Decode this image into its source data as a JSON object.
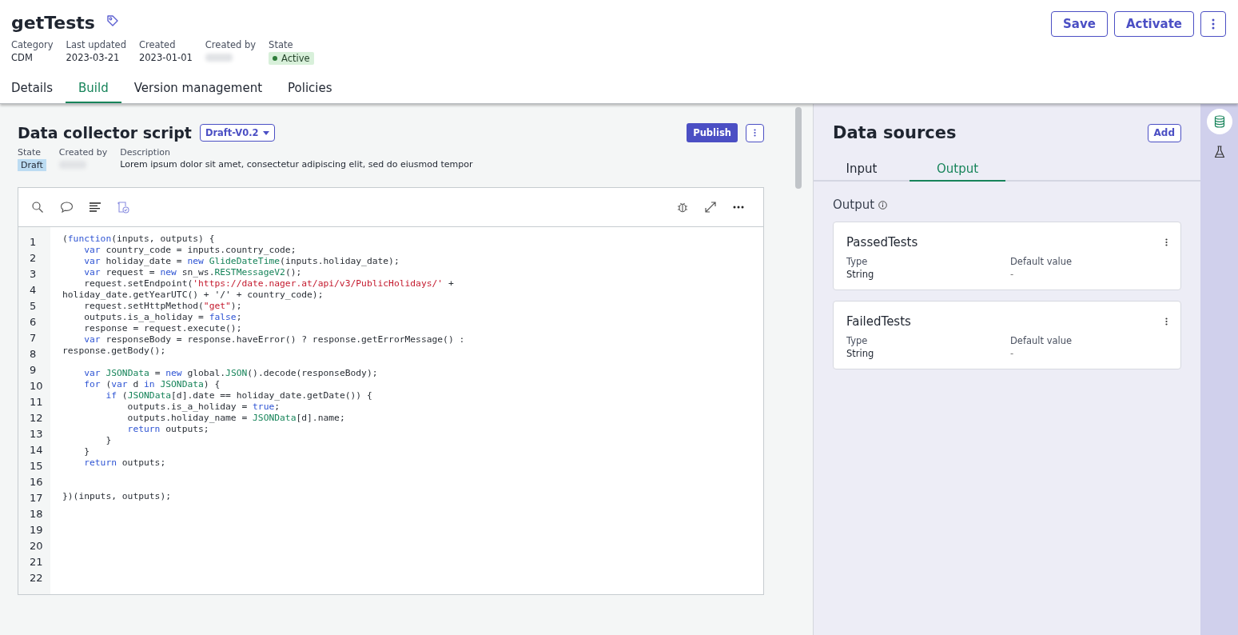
{
  "header": {
    "title": "getTests",
    "actions": [
      "Save",
      "Activate"
    ],
    "meta": [
      {
        "label": "Category",
        "value": "CDM",
        "kind": "text"
      },
      {
        "label": "Last updated",
        "value": "2023-03-21",
        "kind": "text"
      },
      {
        "label": "Created",
        "value": "2023-01-01",
        "kind": "text"
      },
      {
        "label": "Created by",
        "kind": "redacted"
      },
      {
        "label": "State",
        "value": "Active",
        "kind": "status"
      }
    ]
  },
  "tabs": [
    {
      "label": "Details",
      "selected": false
    },
    {
      "label": "Build",
      "selected": true
    },
    {
      "label": "Version management",
      "selected": false
    },
    {
      "label": "Policies",
      "selected": false
    }
  ],
  "script": {
    "title": "Data collector script",
    "version": "Draft-V0.2",
    "publish": "Publish",
    "meta": [
      {
        "label": "State",
        "value": "Draft",
        "kind": "badge"
      },
      {
        "label": "Created by",
        "kind": "redacted"
      },
      {
        "label": "Description",
        "value": "Lorem ipsum dolor sit amet, consectetur adipiscing elit, sed do eiusmod tempor",
        "kind": "text"
      }
    ],
    "line_numbers": [
      "1",
      "2",
      "3",
      "4",
      "5",
      "6",
      "7",
      "8",
      "9",
      "10",
      "11",
      "12",
      "13",
      "14",
      "15",
      "16",
      "17",
      "18",
      "19",
      "20",
      "21",
      "22"
    ],
    "code": [
      {
        "kind": "code",
        "segments": [
          {
            "text": "(",
            "kind": "plain"
          },
          {
            "text": "function",
            "kind": "kw"
          },
          {
            "text": "(inputs, outputs) {",
            "kind": "plain"
          }
        ]
      },
      {
        "kind": "code",
        "segments": [
          {
            "text": "    var",
            "kind": "kw"
          },
          {
            "text": " country_code = inputs.country_code;",
            "kind": "plain"
          }
        ]
      },
      {
        "kind": "code",
        "segments": [
          {
            "text": "    var",
            "kind": "kw"
          },
          {
            "text": " holiday_date = ",
            "kind": "plain"
          },
          {
            "text": "new ",
            "kind": "kw"
          },
          {
            "text": "GlideDateTime",
            "kind": "type"
          },
          {
            "text": "(inputs.holiday_date);",
            "kind": "plain"
          }
        ]
      },
      {
        "kind": "code",
        "segments": [
          {
            "text": "    var",
            "kind": "kw"
          },
          {
            "text": " request = ",
            "kind": "plain"
          },
          {
            "text": "new",
            "kind": "kw"
          },
          {
            "text": " sn_ws.",
            "kind": "plain"
          },
          {
            "text": "RESTMessageV2",
            "kind": "type"
          },
          {
            "text": "();",
            "kind": "plain"
          }
        ]
      },
      {
        "kind": "code",
        "segments": [
          {
            "text": "    request.setEndpoint(",
            "kind": "plain"
          },
          {
            "text": "'https://date.nager.at/api/v3/PublicHolidays/'",
            "kind": "str"
          },
          {
            "text": " +",
            "kind": "plain"
          }
        ]
      },
      {
        "kind": "code",
        "segments": [
          {
            "text": "holiday_date.getYearUTC() + '/' + country_code);",
            "kind": "plain"
          }
        ]
      },
      {
        "kind": "code",
        "segments": [
          {
            "text": "    request.setHttpMethod(",
            "kind": "plain"
          },
          {
            "text": "\"get\"",
            "kind": "str"
          },
          {
            "text": ");",
            "kind": "plain"
          }
        ]
      },
      {
        "kind": "code",
        "segments": [
          {
            "text": "    outputs.is_a_holiday = ",
            "kind": "plain"
          },
          {
            "text": "false",
            "kind": "kw"
          },
          {
            "text": ";",
            "kind": "plain"
          }
        ]
      },
      {
        "kind": "code",
        "segments": [
          {
            "text": "    response = request.execute();",
            "kind": "plain"
          }
        ]
      },
      {
        "kind": "code",
        "segments": [
          {
            "text": "    var",
            "kind": "kw"
          },
          {
            "text": " responseBody = response.haveError() ? response.getErrorMessage() :",
            "kind": "plain"
          }
        ]
      },
      {
        "kind": "code",
        "segments": [
          {
            "text": "response.getBody();",
            "kind": "plain"
          }
        ]
      },
      {
        "kind": "blank"
      },
      {
        "kind": "code",
        "segments": [
          {
            "text": "    var ",
            "kind": "kw"
          },
          {
            "text": "JSONData",
            "kind": "type"
          },
          {
            "text": " = ",
            "kind": "plain"
          },
          {
            "text": "new",
            "kind": "kw"
          },
          {
            "text": " global.",
            "kind": "plain"
          },
          {
            "text": "JSON",
            "kind": "type"
          },
          {
            "text": "().decode(responseBody);",
            "kind": "plain"
          }
        ]
      },
      {
        "kind": "code",
        "segments": [
          {
            "text": "    for",
            "kind": "kw"
          },
          {
            "text": " (",
            "kind": "plain"
          },
          {
            "text": "var",
            "kind": "kw"
          },
          {
            "text": " d ",
            "kind": "plain"
          },
          {
            "text": "in ",
            "kind": "kw"
          },
          {
            "text": "JSONData",
            "kind": "type"
          },
          {
            "text": ") {",
            "kind": "plain"
          }
        ]
      },
      {
        "kind": "code",
        "segments": [
          {
            "text": "        if",
            "kind": "kw"
          },
          {
            "text": " (",
            "kind": "plain"
          },
          {
            "text": "JSONData",
            "kind": "type"
          },
          {
            "text": "[d].date == holiday_date.getDate()) {",
            "kind": "plain"
          }
        ]
      },
      {
        "kind": "code",
        "segments": [
          {
            "text": "            outputs.is_a_holiday = ",
            "kind": "plain"
          },
          {
            "text": "true",
            "kind": "kw"
          },
          {
            "text": ";",
            "kind": "plain"
          }
        ]
      },
      {
        "kind": "code",
        "segments": [
          {
            "text": "            outputs.holiday_name = ",
            "kind": "plain"
          },
          {
            "text": "JSONData",
            "kind": "type"
          },
          {
            "text": "[d].name;",
            "kind": "plain"
          }
        ]
      },
      {
        "kind": "code",
        "segments": [
          {
            "text": "            return",
            "kind": "kw"
          },
          {
            "text": " outputs;",
            "kind": "plain"
          }
        ]
      },
      {
        "kind": "code",
        "segments": [
          {
            "text": "        }",
            "kind": "plain"
          }
        ]
      },
      {
        "kind": "code",
        "segments": [
          {
            "text": "    }",
            "kind": "plain"
          }
        ]
      },
      {
        "kind": "code",
        "segments": [
          {
            "text": "    return",
            "kind": "kw"
          },
          {
            "text": " outputs;",
            "kind": "plain"
          }
        ]
      },
      {
        "kind": "blank"
      },
      {
        "kind": "blank"
      },
      {
        "kind": "code",
        "segments": [
          {
            "text": "})(inputs, outputs);",
            "kind": "plain"
          }
        ]
      }
    ]
  },
  "data_sources": {
    "title": "Data sources",
    "add": "Add",
    "tabs": [
      {
        "label": "Input",
        "selected": false
      },
      {
        "label": "Output",
        "selected": true
      }
    ],
    "section": "Output",
    "items": [
      {
        "name": "PassedTests",
        "type_label": "Type",
        "type": "String",
        "default_label": "Default value",
        "default": "-"
      },
      {
        "name": "FailedTests",
        "type_label": "Type",
        "type": "String",
        "default_label": "Default value",
        "default": "-"
      }
    ]
  },
  "rail": [
    {
      "kind": "database",
      "selected": true
    },
    {
      "kind": "flask",
      "selected": false
    }
  ]
}
